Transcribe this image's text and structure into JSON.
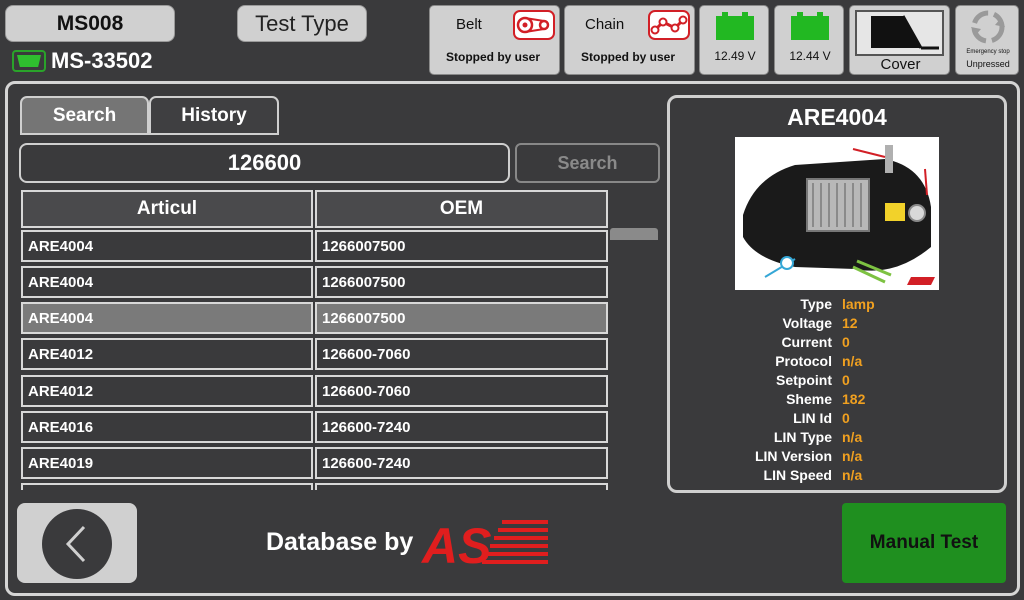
{
  "header": {
    "station_label": "MS008",
    "test_type_label": "Test Type",
    "device_id": "MS-33502"
  },
  "status": {
    "belt": {
      "title": "Belt",
      "state": "Stopped by user"
    },
    "chain": {
      "title": "Chain",
      "state": "Stopped by user"
    },
    "battery1": {
      "voltage": "12.49 V"
    },
    "battery2": {
      "voltage": "12.44 V"
    },
    "cover": {
      "label": "Cover"
    },
    "estop": {
      "title": "Emergency stop",
      "state": "Unpressed"
    }
  },
  "tabs": [
    {
      "label": "Search",
      "active": true
    },
    {
      "label": "History",
      "active": false
    }
  ],
  "search": {
    "value": "126600",
    "button_label": "Search"
  },
  "table": {
    "columns": [
      "Articul",
      "OEM"
    ],
    "rows": [
      {
        "articul": "ARE4004",
        "oem": "1266007500",
        "selected": false
      },
      {
        "articul": "ARE4004",
        "oem": "1266007500",
        "selected": false
      },
      {
        "articul": "ARE4004",
        "oem": "1266007500",
        "selected": true
      },
      {
        "articul": "ARE4012",
        "oem": "126600-7060",
        "selected": false
      },
      {
        "articul": "ARE4012",
        "oem": "126600-7060",
        "selected": false
      },
      {
        "articul": "ARE4016",
        "oem": "126600-7240",
        "selected": false
      },
      {
        "articul": "ARE4019",
        "oem": "126600-7240",
        "selected": false
      }
    ]
  },
  "detail": {
    "title": "ARE4004",
    "fields": [
      {
        "label": "Type",
        "value": "lamp"
      },
      {
        "label": "Voltage",
        "value": "12"
      },
      {
        "label": "Current",
        "value": "0"
      },
      {
        "label": "Protocol",
        "value": "n/a"
      },
      {
        "label": "Setpoint",
        "value": "0"
      },
      {
        "label": "Sheme",
        "value": "182"
      },
      {
        "label": "LIN Id",
        "value": "0"
      },
      {
        "label": "LIN Type",
        "value": "n/a"
      },
      {
        "label": "LIN Version",
        "value": "n/a"
      },
      {
        "label": "LIN Speed",
        "value": "n/a"
      }
    ]
  },
  "footer": {
    "database_by": "Database by",
    "logo_text": "AS",
    "manual_test_label": "Manual Test"
  },
  "colors": {
    "background": "#3a3a3c",
    "accent_value": "#f0a020",
    "ok_green": "#1f8f1f",
    "battery_green": "#22b822",
    "alert_red": "#d21f26"
  }
}
